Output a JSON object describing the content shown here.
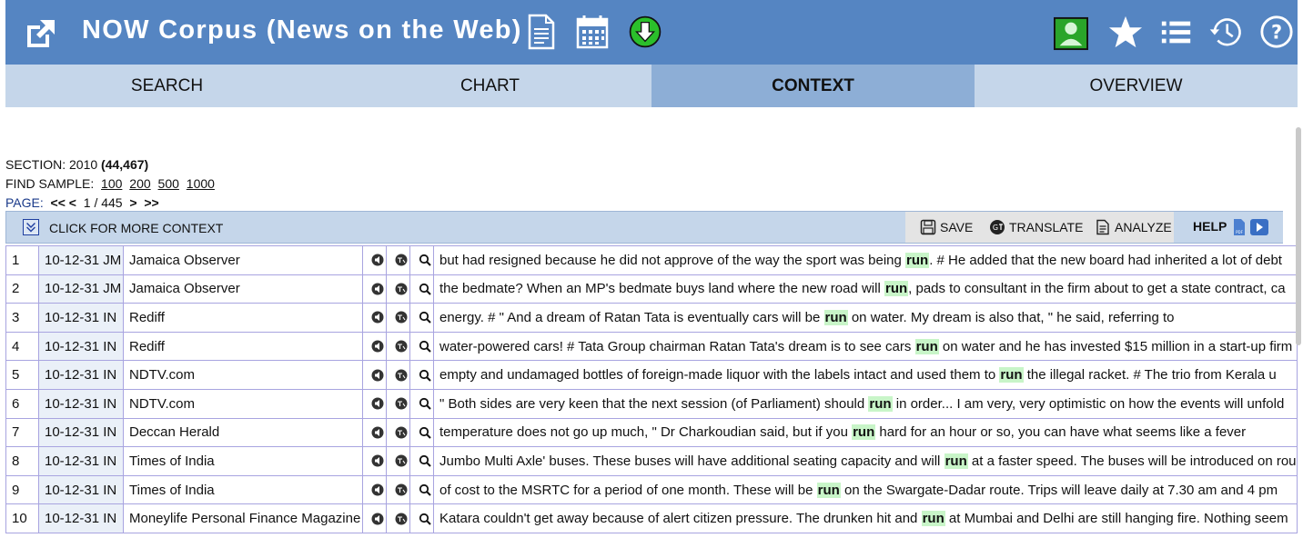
{
  "app": {
    "title": "NOW Corpus (News on the Web)",
    "accent": "#5585c2",
    "tab_bg": "#c5d6ea",
    "tab_active_bg": "#8daed6",
    "keyword_highlight": "#c8f5c8"
  },
  "header_icons": [
    {
      "name": "external-link-icon"
    },
    {
      "name": "document-icon"
    },
    {
      "name": "calendar-icon"
    },
    {
      "name": "download-icon"
    },
    {
      "name": "user-profile-icon"
    },
    {
      "name": "star-icon"
    },
    {
      "name": "list-icon"
    },
    {
      "name": "history-icon"
    },
    {
      "name": "help-icon"
    }
  ],
  "tabs": [
    {
      "label": "SEARCH",
      "active": false
    },
    {
      "label": "CHART",
      "active": false
    },
    {
      "label": "CONTEXT",
      "active": true
    },
    {
      "label": "OVERVIEW",
      "active": false
    }
  ],
  "info": {
    "section_label": "SECTION: 2010",
    "section_count": "(44,467)",
    "find_sample_label": "FIND SAMPLE:",
    "sample_options": [
      "100",
      "200",
      "500",
      "1000"
    ],
    "page_label": "PAGE:",
    "nav_first": "<<",
    "nav_prev": "<",
    "page_status": "1 / 445",
    "nav_next": ">",
    "nav_last": ">>"
  },
  "toolbar": {
    "more_context": "CLICK FOR MORE CONTEXT",
    "save": "SAVE",
    "translate": "TRANSLATE",
    "analyze": "ANALYZE",
    "help": "HELP"
  },
  "rows": [
    {
      "num": "1",
      "date": "10-12-31 JM",
      "source": "Jamaica Observer",
      "left": "but had resigned because he did not approve of the way the sport was being ",
      "kw": "run",
      "right": ". # He added that the new board had inherited a lot of debt"
    },
    {
      "num": "2",
      "date": "10-12-31 JM",
      "source": "Jamaica Observer",
      "left": "the bedmate? When an MP's bedmate buys land where the new road will ",
      "kw": "run",
      "right": ", pads to consultant in the firm about to get a state contract, ca"
    },
    {
      "num": "3",
      "date": "10-12-31 IN",
      "source": "Rediff",
      "left": "energy. # \" And a dream of Ratan Tata is eventually cars will be ",
      "kw": "run",
      "right": " on water. My dream is also that, \" he said, referring to"
    },
    {
      "num": "4",
      "date": "10-12-31 IN",
      "source": "Rediff",
      "left": "water-powered cars! # Tata Group chairman Ratan Tata's dream is to see cars ",
      "kw": "run",
      "right": " on water and he has invested $15 million in a start-up firm"
    },
    {
      "num": "5",
      "date": "10-12-31 IN",
      "source": "NDTV.com",
      "left": "empty and undamaged bottles of foreign-made liquor with the labels intact and used them to ",
      "kw": "run",
      "right": " the illegal racket. # The trio from Kerala u"
    },
    {
      "num": "6",
      "date": "10-12-31 IN",
      "source": "NDTV.com",
      "left": "\" Both sides are very keen that the next session (of Parliament) should ",
      "kw": "run",
      "right": " in order... I am very, very optimistic on how the events will unfold"
    },
    {
      "num": "7",
      "date": "10-12-31 IN",
      "source": "Deccan Herald",
      "left": "temperature does not go up much, \" Dr Charkoudian said, but if you ",
      "kw": "run",
      "right": " hard for an hour or so, you can have what seems like a fever"
    },
    {
      "num": "8",
      "date": "10-12-31 IN",
      "source": "Times of India",
      "left": "Jumbo Multi Axle' buses. These buses will have additional seating capacity and will ",
      "kw": "run",
      "right": " at a faster speed. The buses will be introduced on rou"
    },
    {
      "num": "9",
      "date": "10-12-31 IN",
      "source": "Times of India",
      "left": "of cost to the MSRTC for a period of one month. These will be ",
      "kw": "run",
      "right": " on the Swargate-Dadar route. Trips will leave daily at 7.30 am and 4 pm"
    },
    {
      "num": "10",
      "date": "10-12-31 IN",
      "source": "Moneylife Personal Finance Magazine",
      "left": "Katara couldn't get away because of alert citizen pressure. The drunken hit and ",
      "kw": "run",
      "right": " at Mumbai and Delhi are still hanging fire. Nothing seem"
    }
  ]
}
